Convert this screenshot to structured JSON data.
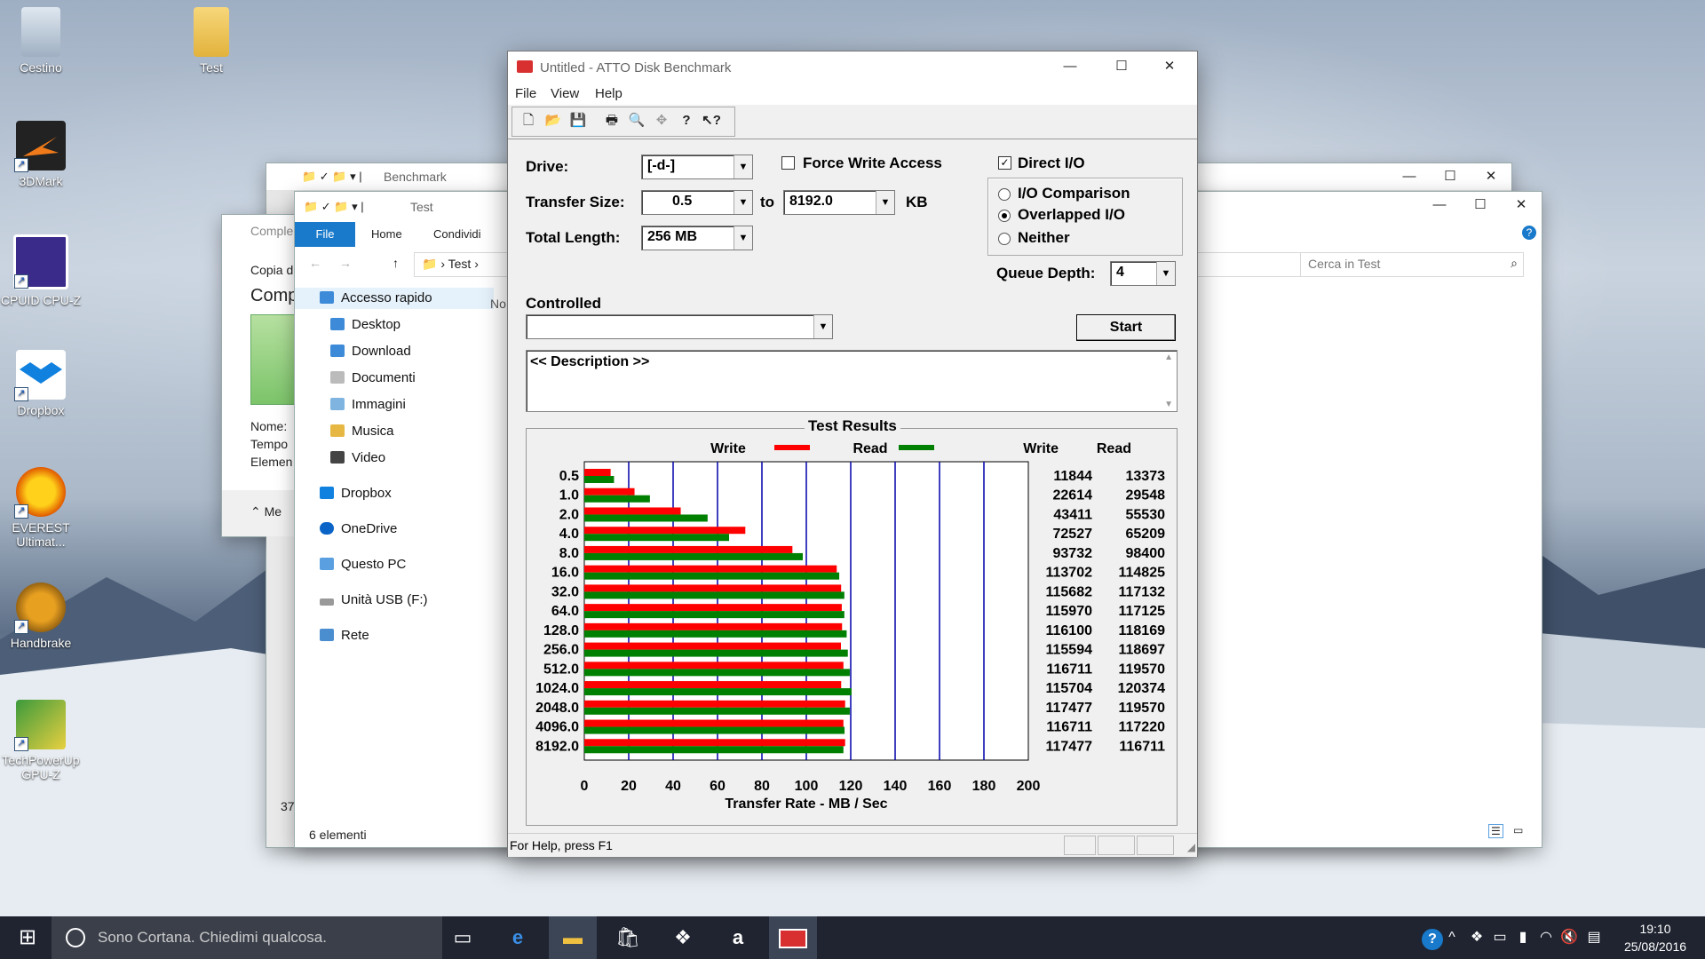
{
  "desktop": {
    "icons": [
      {
        "label": "Cestino"
      },
      {
        "label": "Test"
      },
      {
        "label": "3DMark"
      },
      {
        "label": "CPUID CPU-Z"
      },
      {
        "label": "Dropbox"
      },
      {
        "label": "EVEREST Ultimat..."
      },
      {
        "label": "Handbrake"
      },
      {
        "label": "TechPowerUp GPU-Z"
      }
    ]
  },
  "bench_window": {
    "title": "Benchmark",
    "min": "—",
    "max": "☐",
    "close": "✕"
  },
  "copy_window": {
    "title": "Comple",
    "line1": "Copia d",
    "line2": "Comp",
    "name_label": "Nome:",
    "time_label": "Tempo",
    "elements_label": "Elemen",
    "more": "Me",
    "footer_num": "37"
  },
  "explorer": {
    "title": "Test",
    "tabs": [
      "File",
      "Home",
      "Condividi"
    ],
    "breadcrumb": "Test",
    "search_placeholder": "Cerca in Test",
    "col_header": "No",
    "nav": [
      {
        "label": "Accesso rapido"
      },
      {
        "label": "Desktop"
      },
      {
        "label": "Download"
      },
      {
        "label": "Documenti"
      },
      {
        "label": "Immagini"
      },
      {
        "label": "Musica"
      },
      {
        "label": "Video"
      },
      {
        "label": "Dropbox"
      },
      {
        "label": "OneDrive"
      },
      {
        "label": "Questo PC"
      },
      {
        "label": "Unità USB (F:)"
      },
      {
        "label": "Rete"
      }
    ],
    "status": "6 elementi"
  },
  "atto": {
    "title": "Untitled - ATTO Disk Benchmark",
    "menu": [
      "File",
      "View",
      "Help"
    ],
    "drive_label": "Drive:",
    "drive_value": "[-d-]",
    "force_write_label": "Force Write Access",
    "direct_io_label": "Direct I/O",
    "transfer_size_label": "Transfer Size:",
    "transfer_from": "0.5",
    "to_label": "to",
    "transfer_to": "8192.0",
    "kb_label": "KB",
    "total_length_label": "Total Length:",
    "total_length_value": "256 MB",
    "io_options": [
      "I/O Comparison",
      "Overlapped I/O",
      "Neither"
    ],
    "queue_depth_label": "Queue Depth:",
    "queue_depth_value": "4",
    "controlled_label": "Controlled",
    "start_label": "Start",
    "description": "<< Description >>",
    "results_title": "Test Results",
    "legend_write": "Write",
    "legend_read": "Read",
    "col_write": "Write",
    "col_read": "Read",
    "xlabel": "Transfer Rate - MB / Sec",
    "status_text": "For Help, press F1"
  },
  "chart_data": {
    "type": "bar",
    "orientation": "horizontal",
    "categories": [
      "0.5",
      "1.0",
      "2.0",
      "4.0",
      "8.0",
      "16.0",
      "32.0",
      "64.0",
      "128.0",
      "256.0",
      "512.0",
      "1024.0",
      "2048.0",
      "4096.0",
      "8192.0"
    ],
    "series": [
      {
        "name": "Write",
        "color": "#ff0000",
        "values": [
          11844,
          22614,
          43411,
          72527,
          93732,
          113702,
          115682,
          115970,
          116100,
          115594,
          116711,
          115704,
          117477,
          116711,
          117477
        ]
      },
      {
        "name": "Read",
        "color": "#008000",
        "values": [
          13373,
          29548,
          55530,
          65209,
          98400,
          114825,
          117132,
          117125,
          118169,
          118697,
          119570,
          120374,
          119570,
          117220,
          116711
        ]
      }
    ],
    "value_unit_divisor": 1000,
    "xlim": [
      0,
      200
    ],
    "xticks": [
      "0",
      "20",
      "40",
      "60",
      "80",
      "100",
      "120",
      "140",
      "160",
      "180",
      "200"
    ],
    "title": "Test Results",
    "xlabel": "Transfer Rate - MB / Sec",
    "grid": true
  },
  "taskbar": {
    "cortana": "Sono Cortana. Chiedimi qualcosa.",
    "time": "19:10",
    "date": "25/08/2016"
  }
}
